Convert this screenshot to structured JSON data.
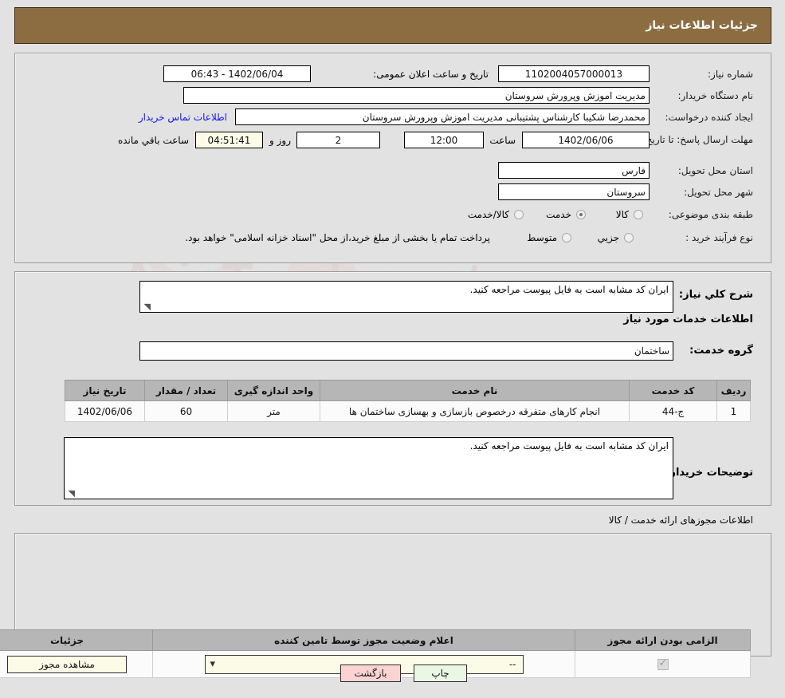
{
  "header": {
    "title": "جزئیات اطلاعات نیاز"
  },
  "watermark": {
    "text": "AriaTender.net"
  },
  "form": {
    "need_number": {
      "label": "شماره نیاز:",
      "value": "1102004057000013"
    },
    "announce": {
      "label": "تاریخ و ساعت اعلان عمومی:",
      "value": "1402/06/04 - 06:43"
    },
    "buyer_org": {
      "label": "نام دستگاه خریدار:",
      "value": "مدیریت اموزش وپرورش سروستان"
    },
    "requester": {
      "label": "ایجاد کننده درخواست:",
      "value": "محمدرضا شکیبا کارشناس پشتیبانی مدیریت اموزش وپرورش سروستان",
      "contact_link": "اطلاعات تماس خریدار"
    },
    "deadline": {
      "label": "مهلت ارسال پاسخ: تا تاریخ:",
      "date": "1402/06/06",
      "hour_label": "ساعت",
      "hour": "12:00",
      "days": "2",
      "days_label": "روز و",
      "countdown": "04:51:41",
      "remaining_label": "ساعت باقي مانده"
    },
    "province": {
      "label": "استان محل تحویل:",
      "value": "فارس"
    },
    "city": {
      "label": "شهر محل تحویل:",
      "value": "سروستان"
    },
    "category": {
      "label": "طبقه بندی موضوعی:",
      "options": [
        "کالا",
        "خدمت",
        "کالا/خدمت"
      ],
      "selected": "خدمت"
    },
    "process_type": {
      "label": "نوع فرآیند خرید :",
      "options": [
        "جزیي",
        "متوسط"
      ],
      "selected": "",
      "note": "پرداخت تمام یا بخشی از مبلغ خرید،از محل \"اسناد خزانه اسلامی\" خواهد بود."
    }
  },
  "description": {
    "label": "شرح کلي نیاز:",
    "value": "ایران کد مشابه است به فایل پیوست مراجعه کنید."
  },
  "services": {
    "section_title": "اطلاعات خدمات مورد نیاز",
    "group_label": "گروه خدمت:",
    "group_value": "ساختمان",
    "columns": [
      "ردیف",
      "کد خدمت",
      "نام خدمت",
      "واحد اندازه گیری",
      "تعداد / مقدار",
      "تاریخ نیاز"
    ],
    "rows": [
      {
        "row": "1",
        "code": "ج-44",
        "name": "انجام کارهای متفرقه درخصوص بازسازی و بهسازی ساختمان ها",
        "unit": "متر",
        "qty": "60",
        "date": "1402/06/06"
      }
    ]
  },
  "buyer_notes": {
    "label": "توضیحات خریدار:",
    "value": "ایران کد مشابه است به فایل پیوست مراجعه کنید."
  },
  "permits": {
    "section_title": "اطلاعات مجوزهای ارائه خدمت / کالا",
    "columns": [
      "الزامی بودن ارائه مجوز",
      "اعلام وضعیت مجوز توسط تامین کننده",
      "جزئیات"
    ],
    "rows": [
      {
        "required": true,
        "status": "--",
        "details_button": "مشاهده مجوز"
      }
    ]
  },
  "footer": {
    "print_label": "چاپ",
    "back_label": "بازگشت"
  },
  "colors": {
    "header_bar": "#8c6d42",
    "link": "#1417f0",
    "print_button": "#e9f7e3",
    "back_button": "#fbd3d3",
    "table_header": "#b6b6b6",
    "page_background": "#e2e2e2"
  }
}
